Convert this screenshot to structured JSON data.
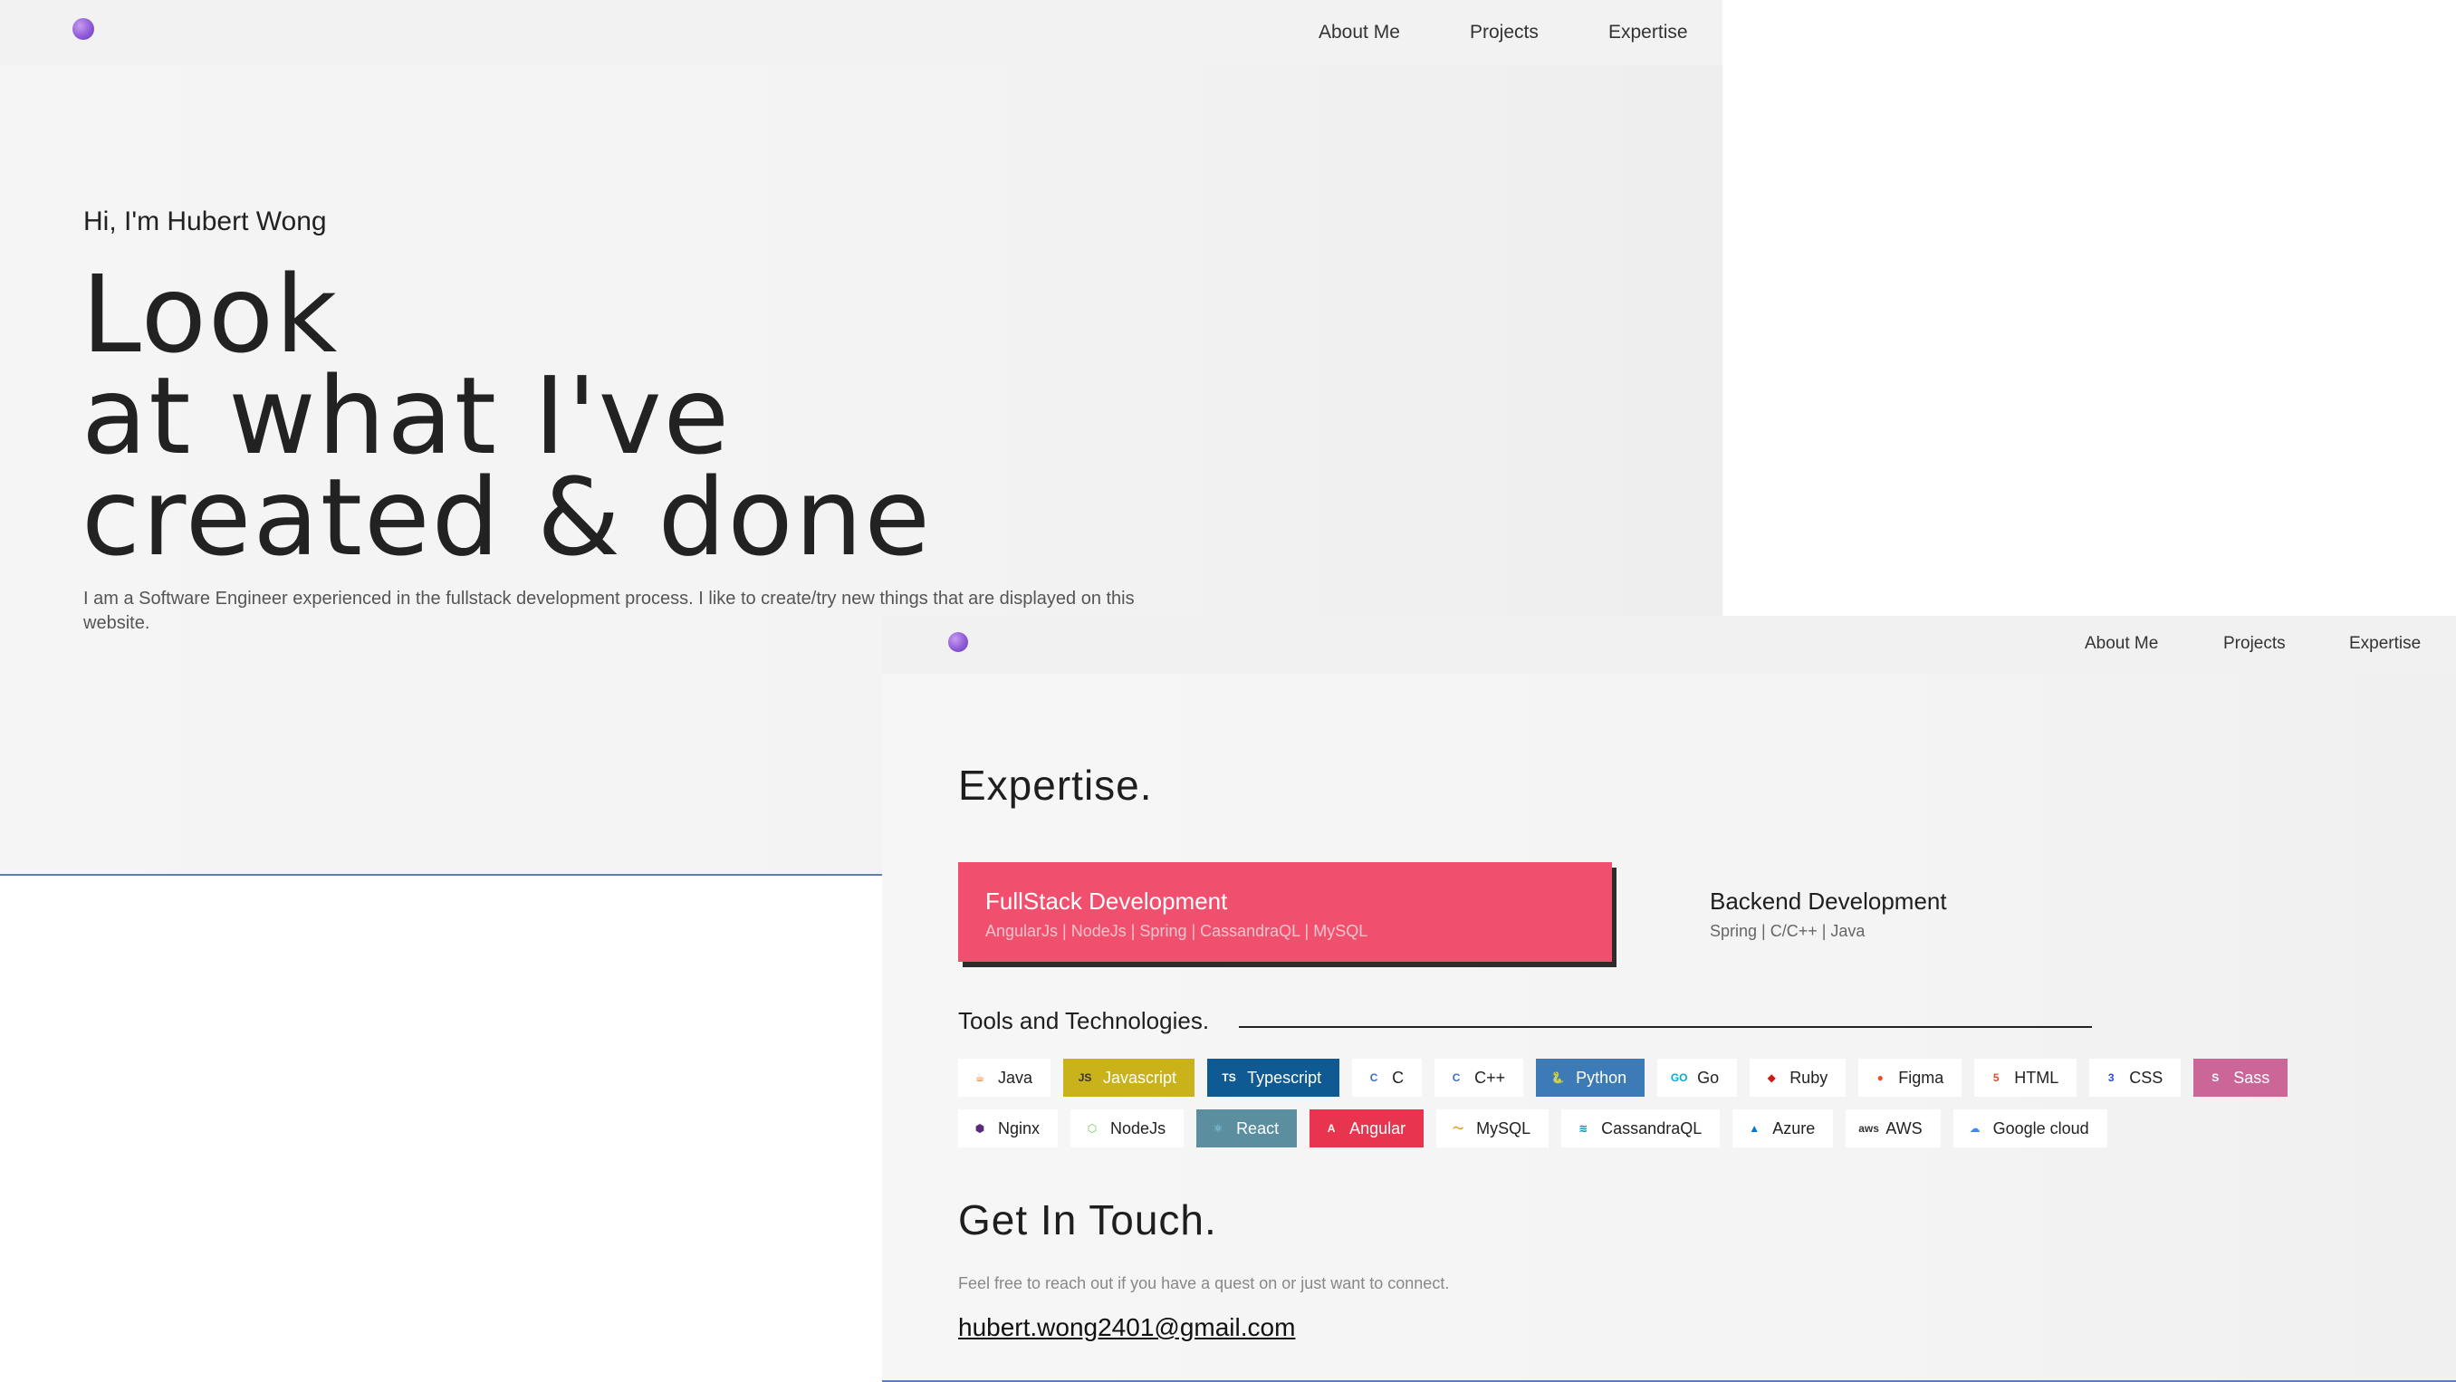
{
  "hero_page": {
    "nav": {
      "about": "About Me",
      "projects": "Projects",
      "expertise": "Expertise"
    },
    "greeting": "Hi, I'm Hubert Wong",
    "headline": [
      "Look",
      "at what I've",
      "created & done"
    ],
    "description": "I am a Software Engineer experienced in the fullstack development process. I like to create/try new things that are displayed on this website."
  },
  "expertise_page": {
    "nav": {
      "about": "About Me",
      "projects": "Projects",
      "expertise": "Expertise"
    },
    "title": "Expertise.",
    "cards": [
      {
        "name": "FullStack Development",
        "stack": "AngularJs | NodeJs | Spring | CassandraQL | MySQL",
        "active": true
      },
      {
        "name": "Backend Development",
        "stack": "Spring | C/C++ | Java",
        "active": false
      }
    ],
    "tools_title": "Tools and Technologies.",
    "tools_row1": [
      {
        "label": "Java",
        "icon": "java-icon",
        "icon_glyph": "☕",
        "icon_color": "#e76f00",
        "bg": "#ffffff",
        "fg": "#222222"
      },
      {
        "label": "Javascript",
        "icon": "javascript-icon",
        "icon_glyph": "JS",
        "icon_color": "#333333",
        "bg": "#c9b21a",
        "fg": "#ffffff"
      },
      {
        "label": "Typescript",
        "icon": "typescript-icon",
        "icon_glyph": "TS",
        "icon_color": "#ffffff",
        "bg": "#0f5a93",
        "fg": "#ffffff"
      },
      {
        "label": "C",
        "icon": "c-icon",
        "icon_glyph": "C",
        "icon_color": "#3a6fc4",
        "bg": "#ffffff",
        "fg": "#222222"
      },
      {
        "label": "C++",
        "icon": "cpp-icon",
        "icon_glyph": "C",
        "icon_color": "#3a6fc4",
        "bg": "#ffffff",
        "fg": "#222222"
      },
      {
        "label": "Python",
        "icon": "python-icon",
        "icon_glyph": "🐍",
        "icon_color": "#f5d34a",
        "bg": "#3d7bb6",
        "fg": "#ffffff"
      },
      {
        "label": "Go",
        "icon": "go-icon",
        "icon_glyph": "GO",
        "icon_color": "#00add8",
        "bg": "#ffffff",
        "fg": "#222222"
      },
      {
        "label": "Ruby",
        "icon": "ruby-icon",
        "icon_glyph": "◆",
        "icon_color": "#cc1a1a",
        "bg": "#ffffff",
        "fg": "#222222"
      },
      {
        "label": "Figma",
        "icon": "figma-icon",
        "icon_glyph": "●",
        "icon_color": "#f24e1e",
        "bg": "#ffffff",
        "fg": "#222222"
      },
      {
        "label": "HTML",
        "icon": "html-icon",
        "icon_glyph": "5",
        "icon_color": "#e44d26",
        "bg": "#ffffff",
        "fg": "#222222"
      },
      {
        "label": "CSS",
        "icon": "css-icon",
        "icon_glyph": "3",
        "icon_color": "#264de4",
        "bg": "#ffffff",
        "fg": "#222222"
      },
      {
        "label": "Sass",
        "icon": "sass-icon",
        "icon_glyph": "S",
        "icon_color": "#ffffff",
        "bg": "#cc6699",
        "fg": "#ffffff"
      }
    ],
    "tools_row2": [
      {
        "label": "Nginx",
        "icon": "nginx-icon",
        "icon_glyph": "⬢",
        "icon_color": "#5a2a7a",
        "bg": "#ffffff",
        "fg": "#222222"
      },
      {
        "label": "NodeJs",
        "icon": "nodejs-icon",
        "icon_glyph": "⬡",
        "icon_color": "#6cc24a",
        "bg": "#ffffff",
        "fg": "#222222"
      },
      {
        "label": "React",
        "icon": "react-icon",
        "icon_glyph": "⚛",
        "icon_color": "#8fd6f0",
        "bg": "#5b8f9f",
        "fg": "#ffffff"
      },
      {
        "label": "Angular",
        "icon": "angular-icon",
        "icon_glyph": "A",
        "icon_color": "#ffffff",
        "bg": "#e8344e",
        "fg": "#ffffff"
      },
      {
        "label": "MySQL",
        "icon": "mysql-icon",
        "icon_glyph": "〜",
        "icon_color": "#e59a1f",
        "bg": "#ffffff",
        "fg": "#222222"
      },
      {
        "label": "CassandraQL",
        "icon": "cassandra-icon",
        "icon_glyph": "≋",
        "icon_color": "#1287b1",
        "bg": "#ffffff",
        "fg": "#222222"
      },
      {
        "label": "Azure",
        "icon": "azure-icon",
        "icon_glyph": "▲",
        "icon_color": "#0078d4",
        "bg": "#ffffff",
        "fg": "#222222"
      },
      {
        "label": "AWS",
        "icon": "aws-icon",
        "icon_glyph": "aws",
        "icon_color": "#333333",
        "bg": "#ffffff",
        "fg": "#222222"
      },
      {
        "label": "Google cloud",
        "icon": "google-cloud-icon",
        "icon_glyph": "☁",
        "icon_color": "#4285f4",
        "bg": "#ffffff",
        "fg": "#222222"
      }
    ],
    "touch_title": "Get In Touch.",
    "touch_desc": "Feel free to reach out if you have a quest on or just want to connect.",
    "email": "hubert.wong2401@gmail.com"
  }
}
